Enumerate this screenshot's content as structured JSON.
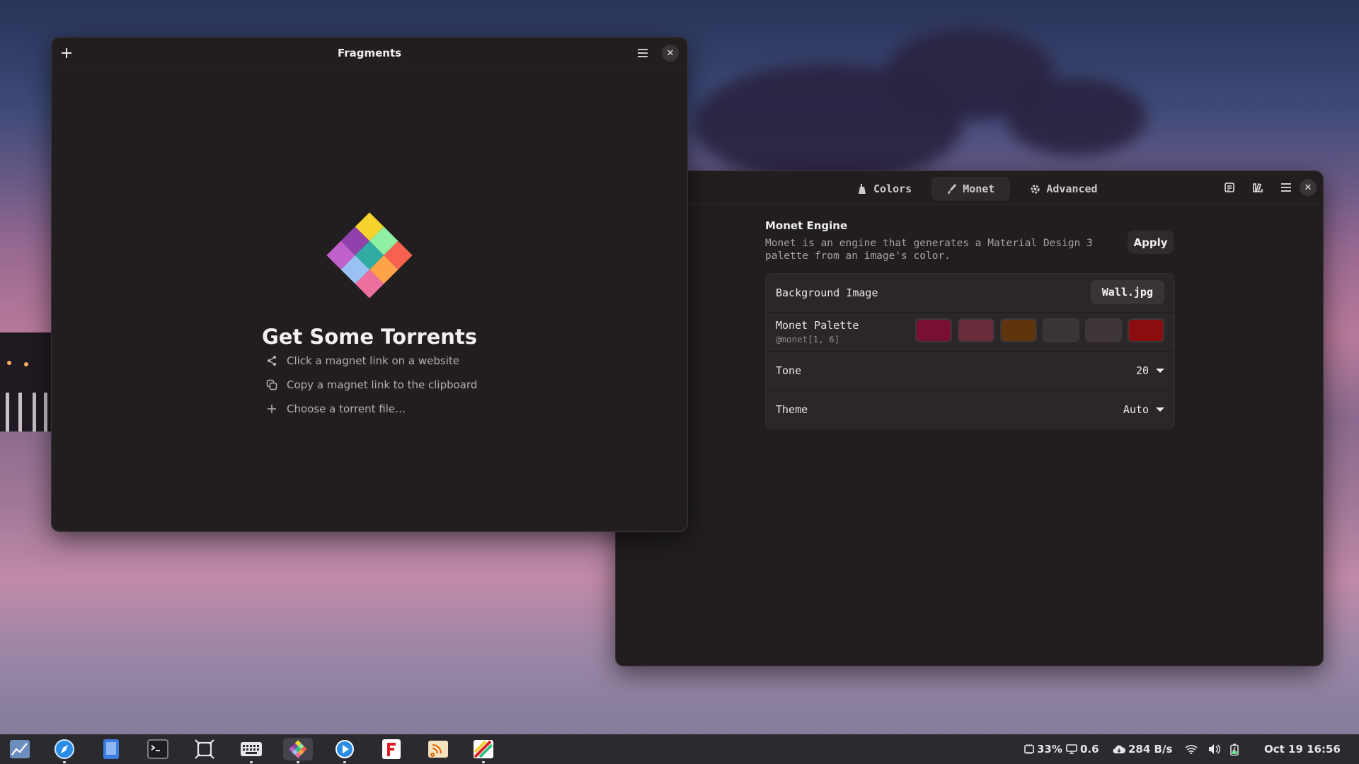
{
  "fragments": {
    "title": "Fragments",
    "status_title": "Get Some Torrents",
    "hints": [
      {
        "icon": "share-icon",
        "label": "Click a magnet link on a website"
      },
      {
        "icon": "copy-icon",
        "label": "Copy a magnet link to the clipboard"
      },
      {
        "icon": "plus-icon",
        "label": "Choose a torrent file…"
      }
    ]
  },
  "gradience": {
    "tabs": [
      {
        "icon": "paint-bucket-icon",
        "label": "Colors"
      },
      {
        "icon": "brush-icon",
        "label": "Monet"
      },
      {
        "icon": "gear-icon",
        "label": "Advanced"
      }
    ],
    "active_tab": "Monet",
    "group_title": "Monet Engine",
    "group_desc": "Monet is an engine that generates a Material Design 3 palette from an image's color.",
    "apply_label": "Apply",
    "rows": {
      "background_image": {
        "label": "Background Image",
        "value": "Wall.jpg"
      },
      "palette": {
        "label": "Monet Palette",
        "sub": "@monet[1, 6]",
        "colors": [
          "#7a0f36",
          "#6a2b3a",
          "#5e350c",
          "#3a3434",
          "#3d3536",
          "#8b0d10"
        ]
      },
      "tone": {
        "label": "Tone",
        "value": "20"
      },
      "theme": {
        "label": "Theme",
        "value": "Auto"
      }
    }
  },
  "taskbar": {
    "cpu": "33%",
    "load": "0.6",
    "net": "284 B/s",
    "clock": "Oct 19 16:56"
  }
}
